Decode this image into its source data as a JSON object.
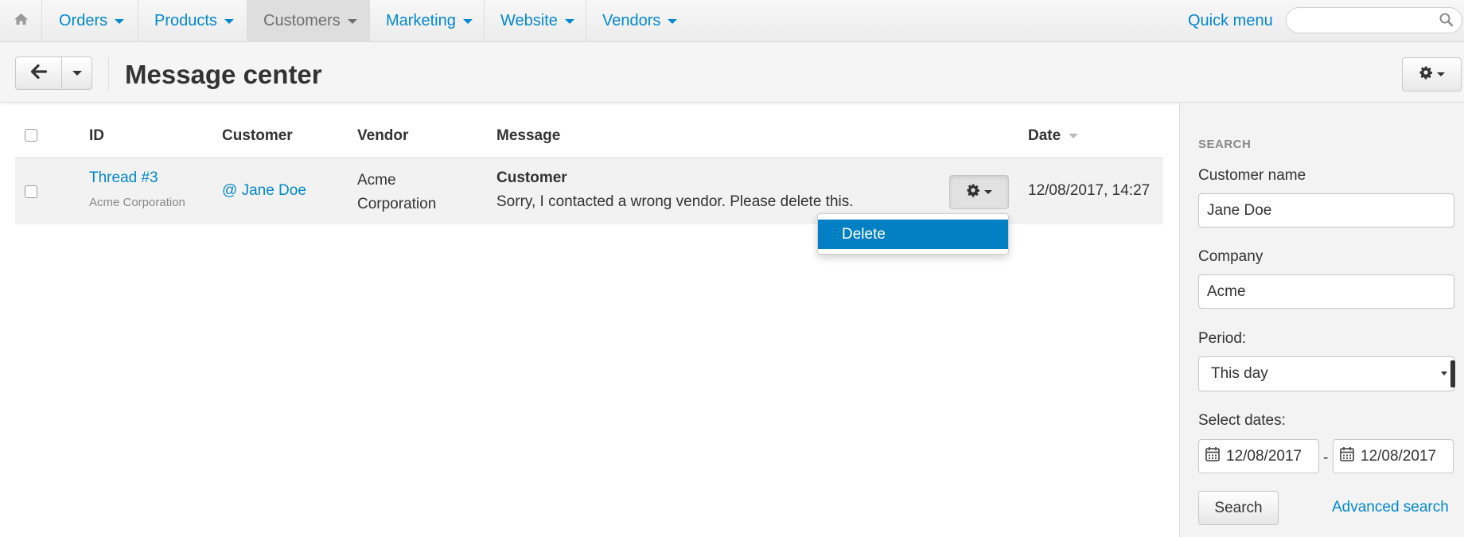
{
  "nav": {
    "items": [
      {
        "label": "Orders"
      },
      {
        "label": "Products"
      },
      {
        "label": "Customers"
      },
      {
        "label": "Marketing"
      },
      {
        "label": "Website"
      },
      {
        "label": "Vendors"
      }
    ],
    "active_item": "Customers",
    "quick_menu": "Quick menu",
    "search_value": ""
  },
  "header": {
    "title": "Message center"
  },
  "table": {
    "columns": [
      "ID",
      "Customer",
      "Vendor",
      "Message",
      "Date"
    ],
    "sorted_column": "Date",
    "rows": [
      {
        "id": "Thread #3",
        "company": "Acme Corporation",
        "customer": "@ Jane Doe",
        "vendor": "Acme Corporation",
        "message_author": "Customer",
        "message_text": "Sorry, I contacted a wrong vendor. Please delete this.",
        "date": "12/08/2017, 14:27"
      }
    ],
    "row_actions": [
      "Delete"
    ]
  },
  "sidebar": {
    "heading": "SEARCH",
    "customer_name_label": "Customer name",
    "customer_name_value": "Jane Doe",
    "company_label": "Company",
    "company_value": "Acme",
    "period_label": "Period:",
    "period_value": "This day",
    "select_dates_label": "Select dates:",
    "date_from": "12/08/2017",
    "date_to": "12/08/2017",
    "date_separator": "-",
    "search_button": "Search",
    "advanced_search": "Advanced search"
  },
  "colors": {
    "link": "#0388cc",
    "highlight": "#0380c3"
  }
}
